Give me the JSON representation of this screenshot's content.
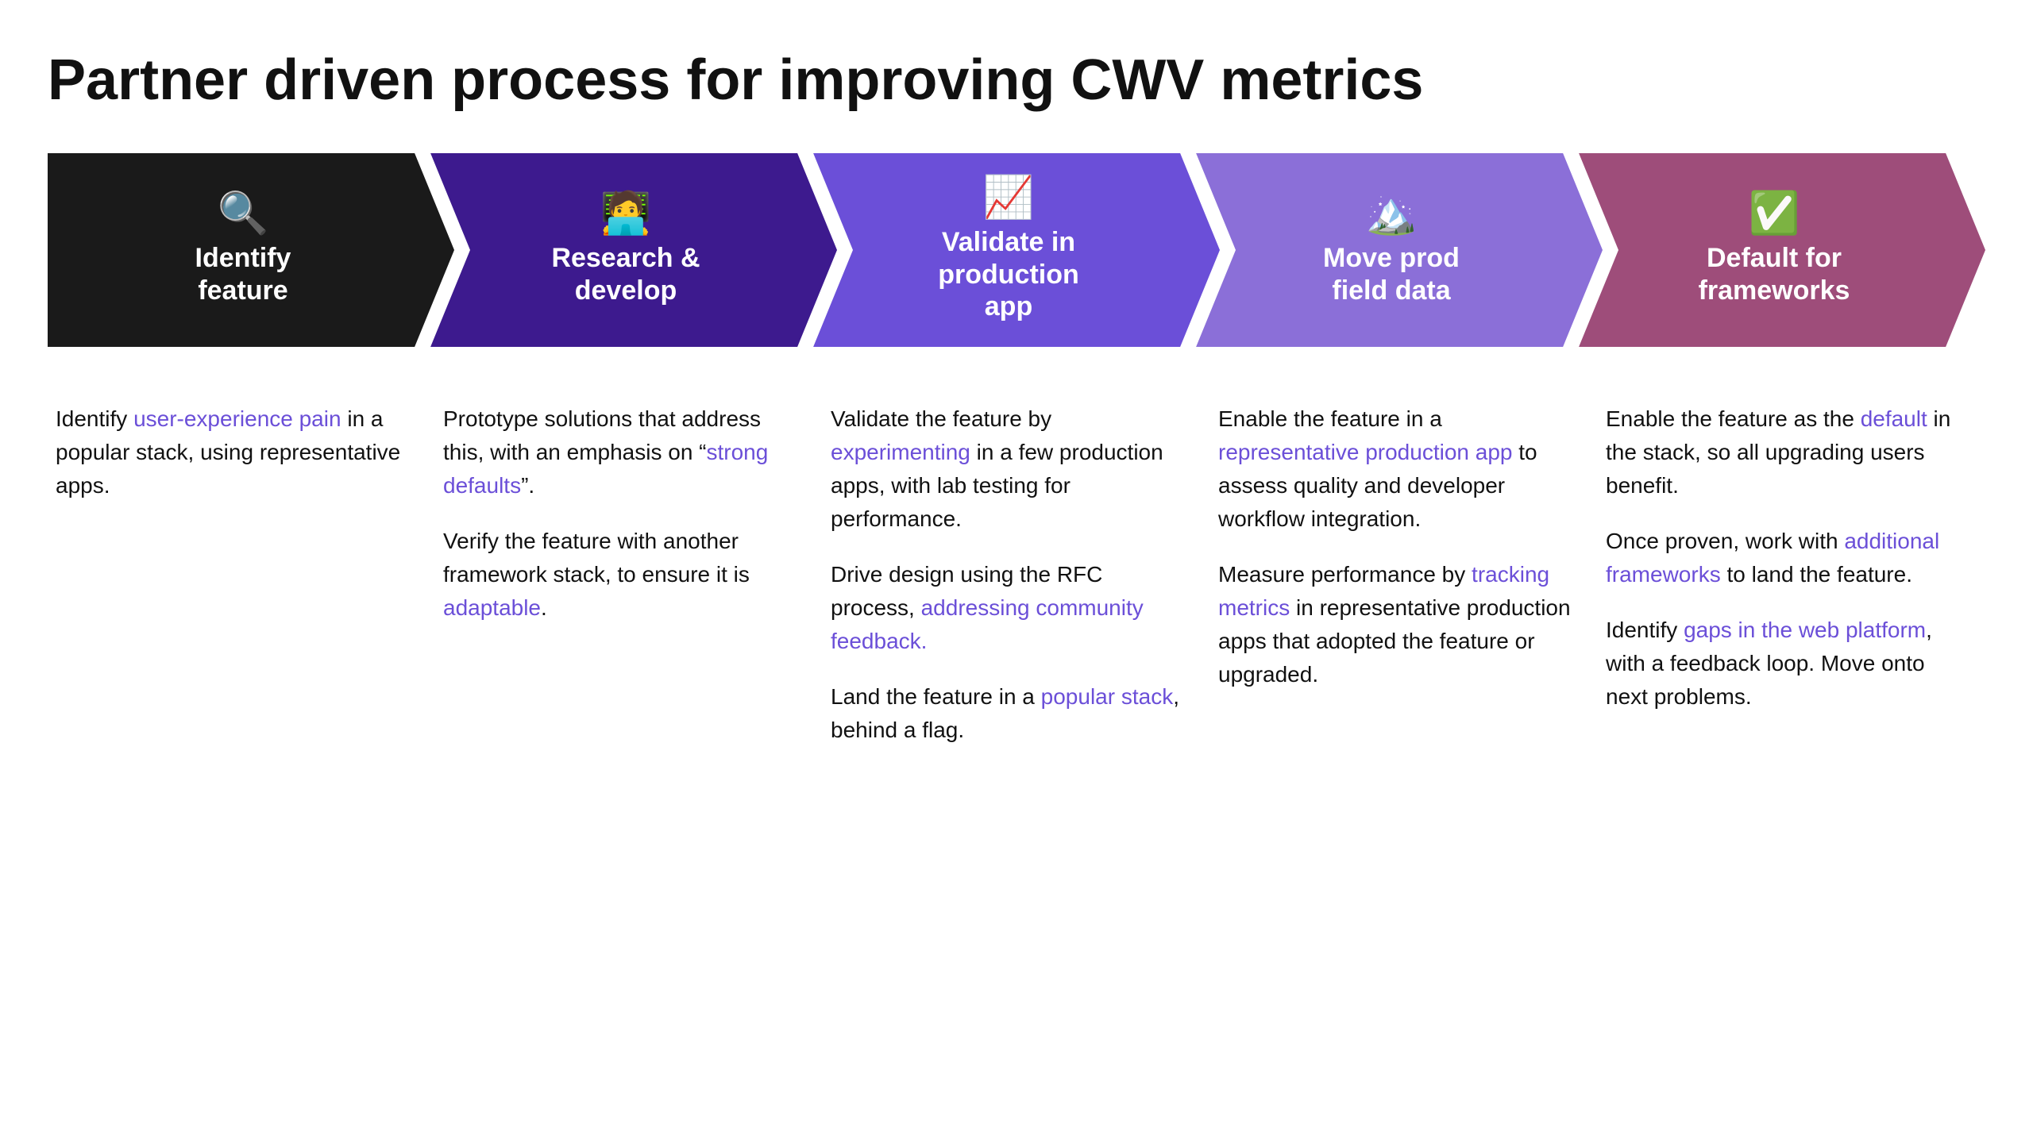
{
  "page": {
    "title": "Partner driven process for improving CWV metrics"
  },
  "arrows": [
    {
      "id": "identify",
      "emoji": "🔍",
      "label": "Identify\nfeature",
      "color": "black",
      "colorClass": "arrow-black",
      "isFirst": true
    },
    {
      "id": "research",
      "emoji": "🧑‍💻",
      "label": "Research &\ndevelop",
      "color": "purple-dark",
      "colorClass": "arrow-purple-dark",
      "isFirst": false
    },
    {
      "id": "validate",
      "emoji": "📈",
      "label": "Validate in\nproduction\napp",
      "color": "purple-mid",
      "colorClass": "arrow-purple-mid",
      "isFirst": false
    },
    {
      "id": "move",
      "emoji": "🏔️",
      "label": "Move prod\nfield data",
      "color": "purple-light",
      "colorClass": "arrow-purple-light",
      "isFirst": false
    },
    {
      "id": "default",
      "emoji": "✅",
      "label": "Default for\nframeworks",
      "color": "mauve",
      "colorClass": "arrow-mauve",
      "isFirst": false
    }
  ],
  "columns": [
    {
      "id": "identify-content",
      "paragraphs": [
        {
          "parts": [
            {
              "text": "Identify ",
              "type": "plain"
            },
            {
              "text": "user-experience pain",
              "type": "link"
            },
            {
              "text": " in a popular stack, using representative apps.",
              "type": "plain"
            }
          ]
        }
      ]
    },
    {
      "id": "research-content",
      "paragraphs": [
        {
          "parts": [
            {
              "text": "Prototype solutions that address this, with an emphasis on “",
              "type": "plain"
            },
            {
              "text": "strong defaults",
              "type": "link"
            },
            {
              "text": "”.",
              "type": "plain"
            }
          ]
        },
        {
          "parts": [
            {
              "text": "Verify the feature with another framework stack, to ensure it is ",
              "type": "plain"
            },
            {
              "text": "adaptable",
              "type": "link"
            },
            {
              "text": ".",
              "type": "plain"
            }
          ]
        }
      ]
    },
    {
      "id": "validate-content",
      "paragraphs": [
        {
          "parts": [
            {
              "text": "Validate the feature by ",
              "type": "plain"
            },
            {
              "text": "experimenting",
              "type": "link"
            },
            {
              "text": " in a few production apps, with lab testing for performance.",
              "type": "plain"
            }
          ]
        },
        {
          "parts": [
            {
              "text": "Drive design using the RFC process, ",
              "type": "plain"
            },
            {
              "text": "addressing community feedback.",
              "type": "link"
            }
          ]
        },
        {
          "parts": [
            {
              "text": "Land the feature in a ",
              "type": "plain"
            },
            {
              "text": "popular stack",
              "type": "link"
            },
            {
              "text": ", behind a flag.",
              "type": "plain"
            }
          ]
        }
      ]
    },
    {
      "id": "move-content",
      "paragraphs": [
        {
          "parts": [
            {
              "text": "Enable the feature in a ",
              "type": "plain"
            },
            {
              "text": "representative production app",
              "type": "link"
            },
            {
              "text": " to assess quality and developer workflow integration.",
              "type": "plain"
            }
          ]
        },
        {
          "parts": [
            {
              "text": "Measure performance by ",
              "type": "plain"
            },
            {
              "text": "tracking metrics",
              "type": "link"
            },
            {
              "text": " in representative production apps that adopted the feature or upgraded.",
              "type": "plain"
            }
          ]
        }
      ]
    },
    {
      "id": "default-content",
      "paragraphs": [
        {
          "parts": [
            {
              "text": "Enable the feature as the ",
              "type": "plain"
            },
            {
              "text": "default",
              "type": "link"
            },
            {
              "text": " in the stack, so all upgrading users benefit.",
              "type": "plain"
            }
          ]
        },
        {
          "parts": [
            {
              "text": "Once proven, work with ",
              "type": "plain"
            },
            {
              "text": "additional frameworks",
              "type": "link"
            },
            {
              "text": " to land the feature.",
              "type": "plain"
            }
          ]
        },
        {
          "parts": [
            {
              "text": "Identify ",
              "type": "plain"
            },
            {
              "text": "gaps in the web platform",
              "type": "link"
            },
            {
              "text": ", with a feedback loop. Move onto next problems.",
              "type": "plain"
            }
          ]
        }
      ]
    }
  ]
}
